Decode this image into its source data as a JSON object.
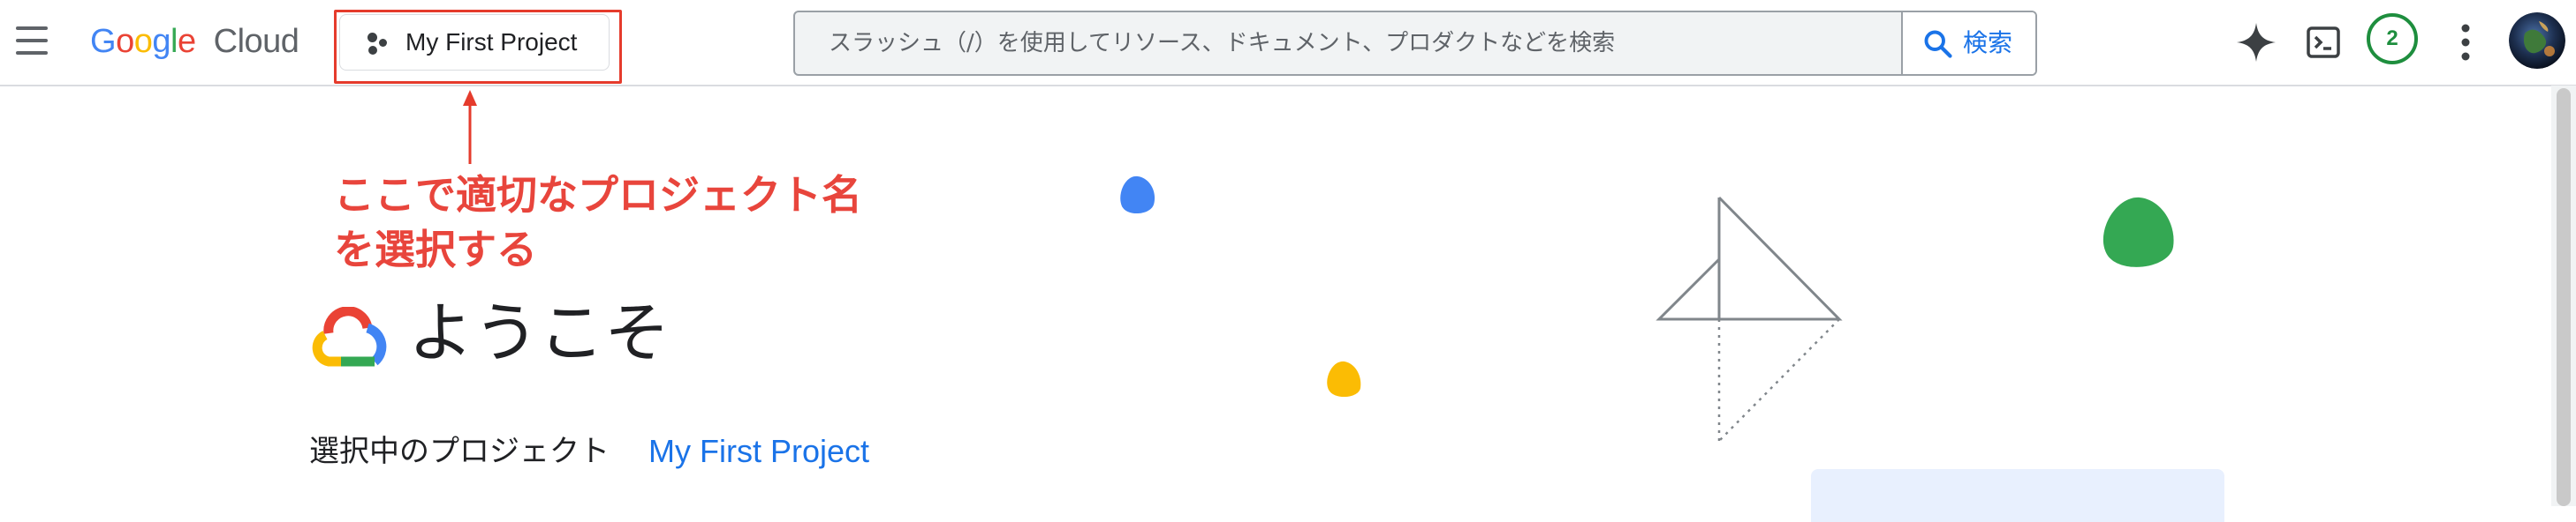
{
  "header": {
    "logo": {
      "google": [
        "G",
        "o",
        "o",
        "g",
        "l",
        "e"
      ],
      "cloud": "Cloud"
    },
    "project_picker_label": "My First Project",
    "search": {
      "placeholder": "スラッシュ（/）を使用してリソース、ドキュメント、プロダクトなどを検索",
      "button_label": "検索"
    },
    "notification_count": "2",
    "icons": [
      "menu-icon",
      "gemini-sparkle-icon",
      "cloud-shell-icon",
      "more-vert-icon"
    ]
  },
  "annotation": {
    "line1": "ここで適切なプロジェクト名",
    "line2": "を選択する",
    "color": "#e8453c"
  },
  "main": {
    "welcome_title": "ようこそ",
    "selected_project_label": "選択中のプロジェクト",
    "selected_project_link": "My First Project"
  },
  "colors": {
    "google_blue": "#4285f4",
    "google_red": "#ea4335",
    "google_yellow": "#fbbc04",
    "google_green": "#34a853",
    "link_blue": "#1a73e8",
    "highlight_red": "#e53b2c"
  }
}
